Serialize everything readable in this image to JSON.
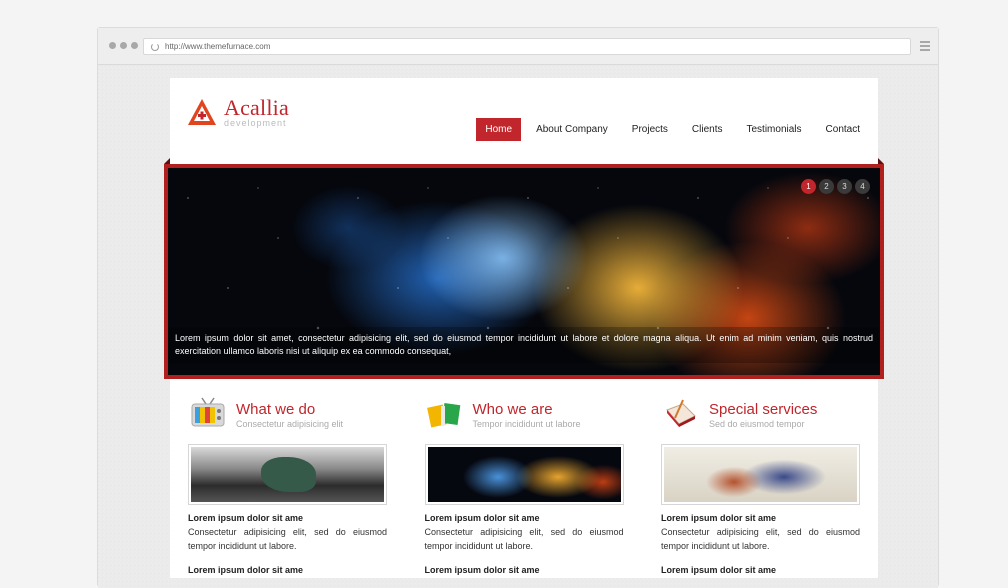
{
  "browser": {
    "url": "http://www.themefurnace.com"
  },
  "logo": {
    "name": "Acallia",
    "tagline": "development"
  },
  "nav": {
    "items": [
      {
        "label": "Home",
        "active": true
      },
      {
        "label": "About Company",
        "active": false
      },
      {
        "label": "Projects",
        "active": false
      },
      {
        "label": "Clients",
        "active": false
      },
      {
        "label": "Testimonials",
        "active": false
      },
      {
        "label": "Contact",
        "active": false
      }
    ]
  },
  "slider": {
    "pages": [
      "1",
      "2",
      "3",
      "4"
    ],
    "active_page": "1",
    "caption": "Lorem ipsum dolor sit amet, consectetur adipisicing elit, sed do eiusmod tempor incididunt ut labore et dolore magna aliqua. Ut enim ad minim veniam, quis nostrud exercitation ullamco laboris nisi ut aliquip ex ea commodo consequat,"
  },
  "features": [
    {
      "icon": "tv-icon",
      "title": "What we do",
      "subtitle": "Consectetur adipisicing elit",
      "lead": "Lorem ipsum dolor sit ame",
      "text": "Consectetur adipisicing elit, sed do eiusmod tempor incididunt ut labore.",
      "lead2": "Lorem ipsum dolor sit ame"
    },
    {
      "icon": "books-icon",
      "title": "Who we are",
      "subtitle": "Tempor incididunt ut labore",
      "lead": "Lorem ipsum dolor sit ame",
      "text": "Consectetur adipisicing elit, sed do eiusmod tempor incididunt ut labore.",
      "lead2": "Lorem ipsum dolor sit ame"
    },
    {
      "icon": "notebook-icon",
      "title": "Special services",
      "subtitle": "Sed do eiusmod tempor",
      "lead": "Lorem ipsum dolor sit ame",
      "text": "Consectetur adipisicing elit, sed do eiusmod tempor incididunt ut labore.",
      "lead2": "Lorem ipsum dolor sit ame"
    }
  ],
  "colors": {
    "accent": "#c0262b",
    "slider_frame": "#b0201f"
  }
}
